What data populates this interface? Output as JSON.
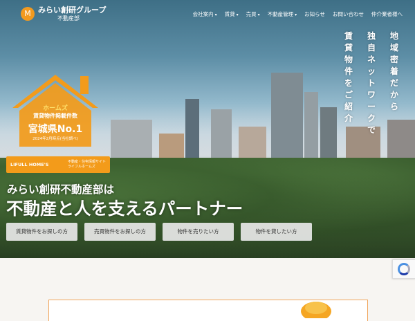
{
  "brand": {
    "name": "みらい創研グループ",
    "sub": "不動産部",
    "mark": "M"
  },
  "nav": [
    {
      "label": "会社案内",
      "dropdown": true
    },
    {
      "label": "賃貸",
      "dropdown": true
    },
    {
      "label": "売買",
      "dropdown": true
    },
    {
      "label": "不動産管理",
      "dropdown": true
    },
    {
      "label": "お知らせ",
      "dropdown": false
    },
    {
      "label": "お問い合わせ",
      "dropdown": false
    },
    {
      "label": "仲介業者様へ",
      "dropdown": false
    }
  ],
  "tagline_vertical": {
    "col1": "地域密着だから",
    "col2": "独自ネットワークで",
    "col3": "賃貸物件をご紹介"
  },
  "badge": {
    "line1": "ホームズ",
    "line2": "賃貸物件掲載件数",
    "line3": "宮城県No.1",
    "line4": "2024年2月時点(当社調べ)"
  },
  "homes": {
    "logo": "LIFULL HOME'S",
    "sub1": "不動産・住宅情報サイト",
    "sub2": "ライフルホームズ"
  },
  "hero": {
    "catch1": "みらい創研不動産部は",
    "catch2": "不動産と人を支えるパートナー"
  },
  "ctas": [
    {
      "label": "賃貸物件をお探しの方"
    },
    {
      "label": "売買物件をお探しの方"
    },
    {
      "label": "物件を売りたい方"
    },
    {
      "label": "物件を貸したい方"
    }
  ],
  "colors": {
    "accent": "#f29a1f",
    "cta_bg": "#e8e8e8"
  }
}
